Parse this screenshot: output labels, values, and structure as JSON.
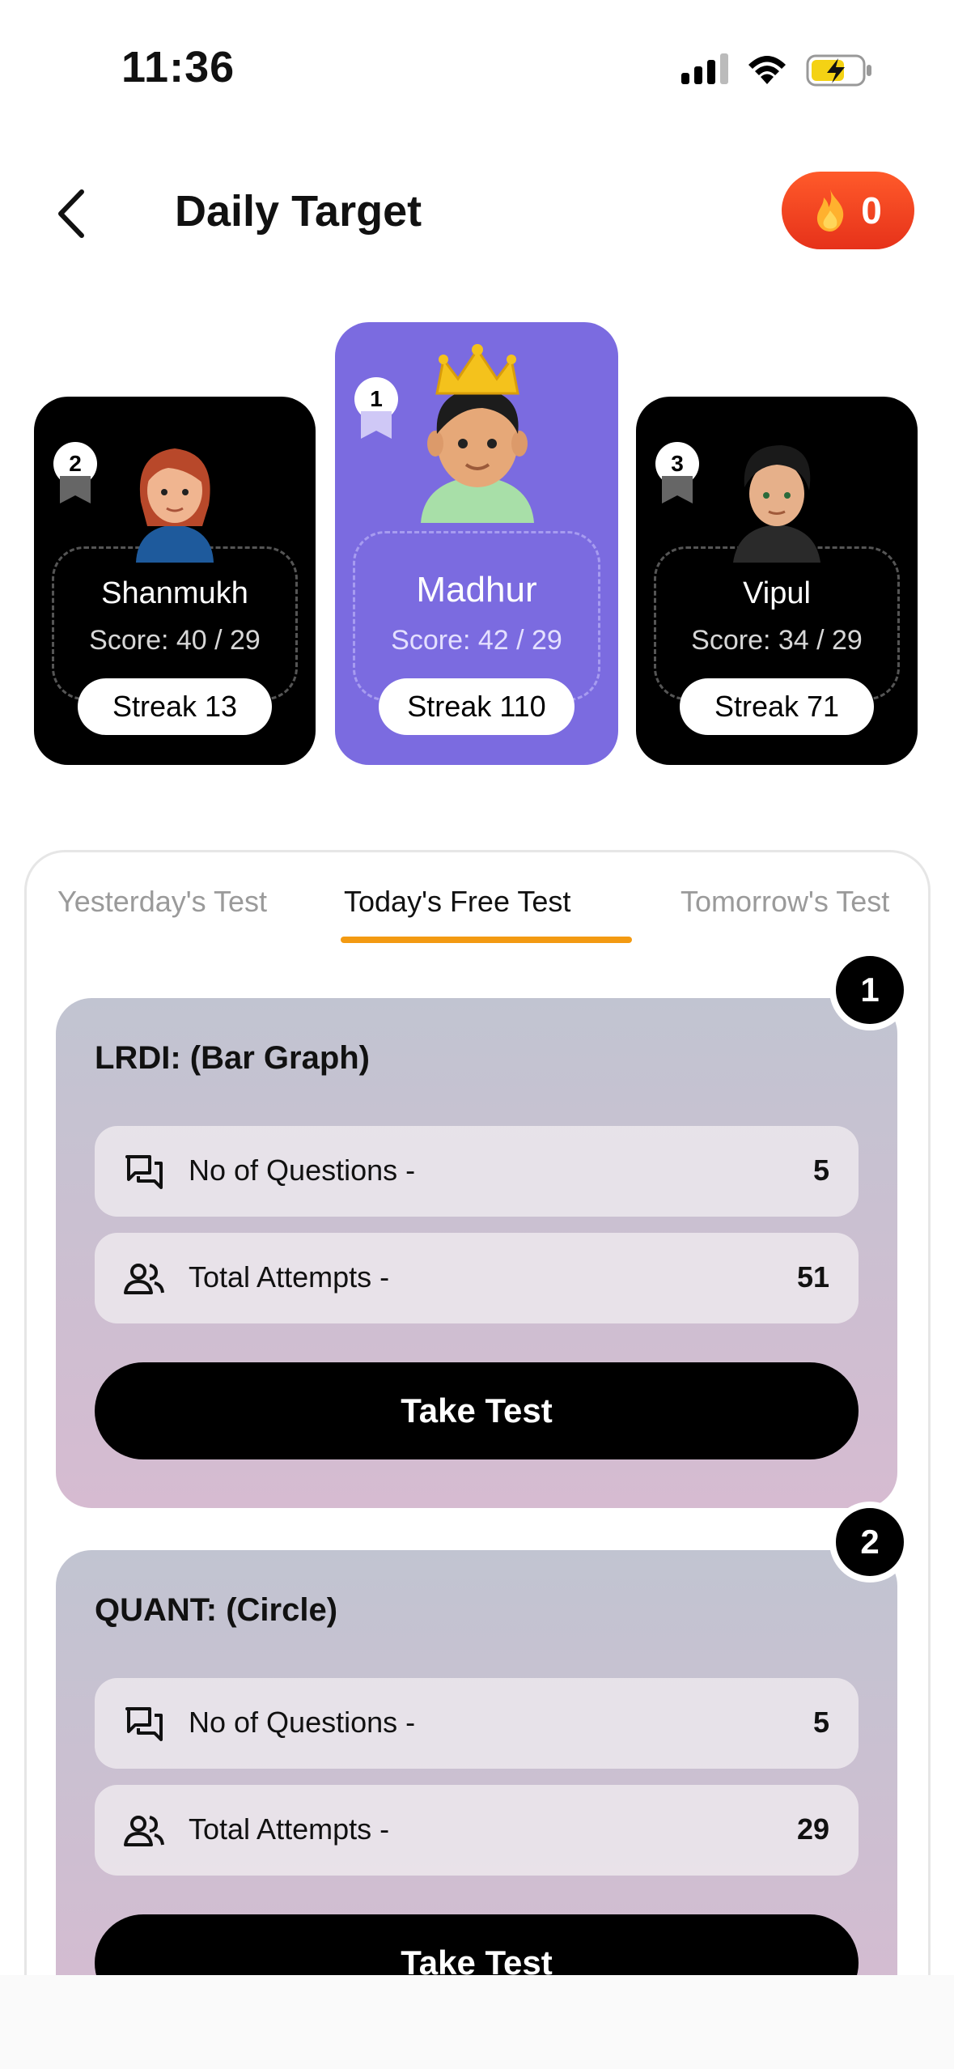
{
  "status_bar": {
    "time": "11:36"
  },
  "header": {
    "title": "Daily Target",
    "streak_count": "0"
  },
  "leaderboard": [
    {
      "rank": "2",
      "name": "Shanmukh",
      "score": "Score: 40 / 29",
      "streak": "Streak 13"
    },
    {
      "rank": "1",
      "name": "Madhur",
      "score": "Score: 42 / 29",
      "streak": "Streak 110"
    },
    {
      "rank": "3",
      "name": "Vipul",
      "score": "Score: 34 / 29",
      "streak": "Streak 71"
    }
  ],
  "tabs": [
    {
      "label": "Yesterday's Test",
      "active": false
    },
    {
      "label": "Today's Free Test",
      "active": true
    },
    {
      "label": "Tomorrow's Test",
      "active": false
    }
  ],
  "tests": [
    {
      "number": "1",
      "title": "LRDI: (Bar Graph)",
      "questions_label": "No of Questions -",
      "questions_value": "5",
      "attempts_label": "Total Attempts -",
      "attempts_value": "51",
      "button": "Take Test"
    },
    {
      "number": "2",
      "title": "QUANT: (Circle)",
      "questions_label": "No of Questions -",
      "questions_value": "5",
      "attempts_label": "Total Attempts -",
      "attempts_value": "29",
      "button": "Take Test"
    }
  ],
  "colors": {
    "accent_orange": "#f39a12",
    "streak_red": "#e6321a",
    "first_place_purple": "#7b6be0",
    "card_gradient_top": "#c1c4d1",
    "card_gradient_bottom": "#d6bbd1"
  }
}
